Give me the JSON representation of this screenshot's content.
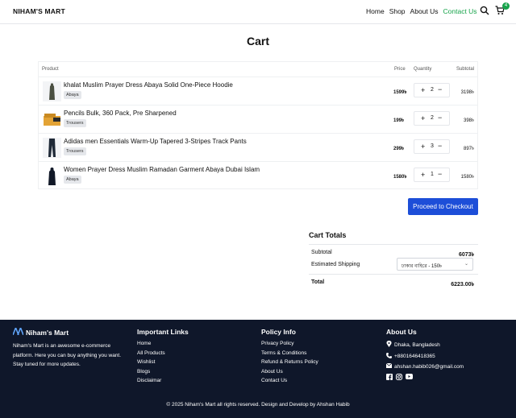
{
  "header": {
    "brand": "NIHAM'S MART",
    "nav": [
      "Home",
      "Shop",
      "About Us",
      "Contact Us"
    ],
    "active_nav": "Contact Us",
    "cart_count": "4",
    "accent_color": "#16a34a"
  },
  "cart": {
    "title": "Cart",
    "columns": {
      "product": "Product",
      "price": "Price",
      "quantity": "Quantity",
      "subtotal": "Subtotal"
    },
    "items": [
      {
        "name": "khalat Muslim Prayer Dress Abaya Solid One-Piece Hoodie",
        "category": "Abaya",
        "price": "1599৳",
        "qty": "2",
        "subtotal": "3198৳"
      },
      {
        "name": "Pencils Bulk, 360 Pack, Pre Sharpened",
        "category": "Trousers",
        "price": "199৳",
        "qty": "2",
        "subtotal": "398৳"
      },
      {
        "name": "Adidas men Essentials Warm-Up Tapered 3-Stripes Track Pants",
        "category": "Trousers",
        "price": "299৳",
        "qty": "3",
        "subtotal": "897৳"
      },
      {
        "name": "Women Prayer Dress Muslim Ramadan Garment Abaya Dubai Islam",
        "category": "Abaya",
        "price": "1580৳",
        "qty": "1",
        "subtotal": "1580৳"
      }
    ],
    "checkout_label": "Proceed to Checkout",
    "button_color": "#1d4ed8"
  },
  "totals": {
    "title": "Cart Totals",
    "subtotal_label": "Subtotal",
    "subtotal_value": "6073৳",
    "shipping_label": "Estimated Shipping",
    "shipping_option": "ঢাকার বাহিরে - 150৳",
    "total_label": "Total",
    "total_value": "6223.00৳"
  },
  "footer": {
    "brand": "Niham's Mart",
    "about": "Niham's Mart is an awesome e-commerce platform. Here you can buy anything you want. Stay tuned for more updates.",
    "important_title": "Important Links",
    "important_links": [
      "Home",
      "All Products",
      "Wishlist",
      "Blogs",
      "Disclaimar"
    ],
    "policy_title": "Policy Info",
    "policy_links": [
      "Privacy Policy",
      "Terms & Conditions",
      "Refund & Returns Policy",
      "About Us",
      "Contact Us"
    ],
    "about_title": "About Us",
    "address": "Dhaka, Bangladesh",
    "phone": "+8801646418365",
    "email": "ahshan.habib026@gmail.com",
    "copyright": "© 2025 Niham's Mart all rights reserved. Design and Develop by Ahshan Habib",
    "bg_color": "#0f172a"
  }
}
